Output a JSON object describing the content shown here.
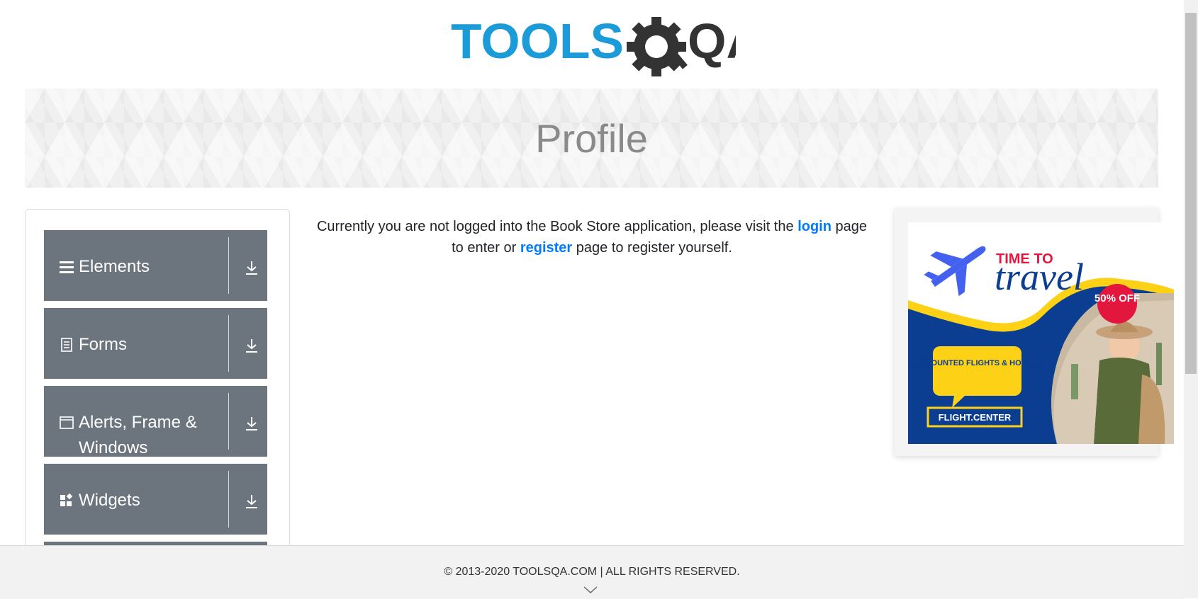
{
  "logo": {
    "tools_text": "TOOLS",
    "qa_text": "QA"
  },
  "banner": {
    "title": "Profile"
  },
  "sidebar": {
    "groups": [
      {
        "label": "Elements",
        "icon": "menu-icon"
      },
      {
        "label": "Forms",
        "icon": "form-icon"
      },
      {
        "label": "Alerts, Frame & Windows",
        "icon": "window-icon"
      },
      {
        "label": "Widgets",
        "icon": "widgets-icon"
      }
    ]
  },
  "message": {
    "part1": "Currently you are not logged into the Book Store application, please visit the",
    "login_link": "login",
    "part2": "page to enter or",
    "register_link": "register",
    "part3": "page to register yourself."
  },
  "ad": {
    "headline_small": "TIME TO",
    "headline_big": "travel",
    "badge": "50% OFF",
    "bubble": "DISCOUNTED FLIGHTS & HOTELS",
    "brand": "FLIGHT.CENTER",
    "close_label": "✕"
  },
  "footer": {
    "copyright": "© 2013-2020 TOOLSQA.COM | ALL RIGHTS RESERVED."
  },
  "colors": {
    "logo_blue": "#1b9bd7",
    "logo_dark": "#333333",
    "sidebar_bg": "#6c757d",
    "link_blue": "#007bff",
    "ad_navy": "#0b3d91",
    "ad_yellow": "#fcd116",
    "ad_badge_red": "#e3173e"
  }
}
